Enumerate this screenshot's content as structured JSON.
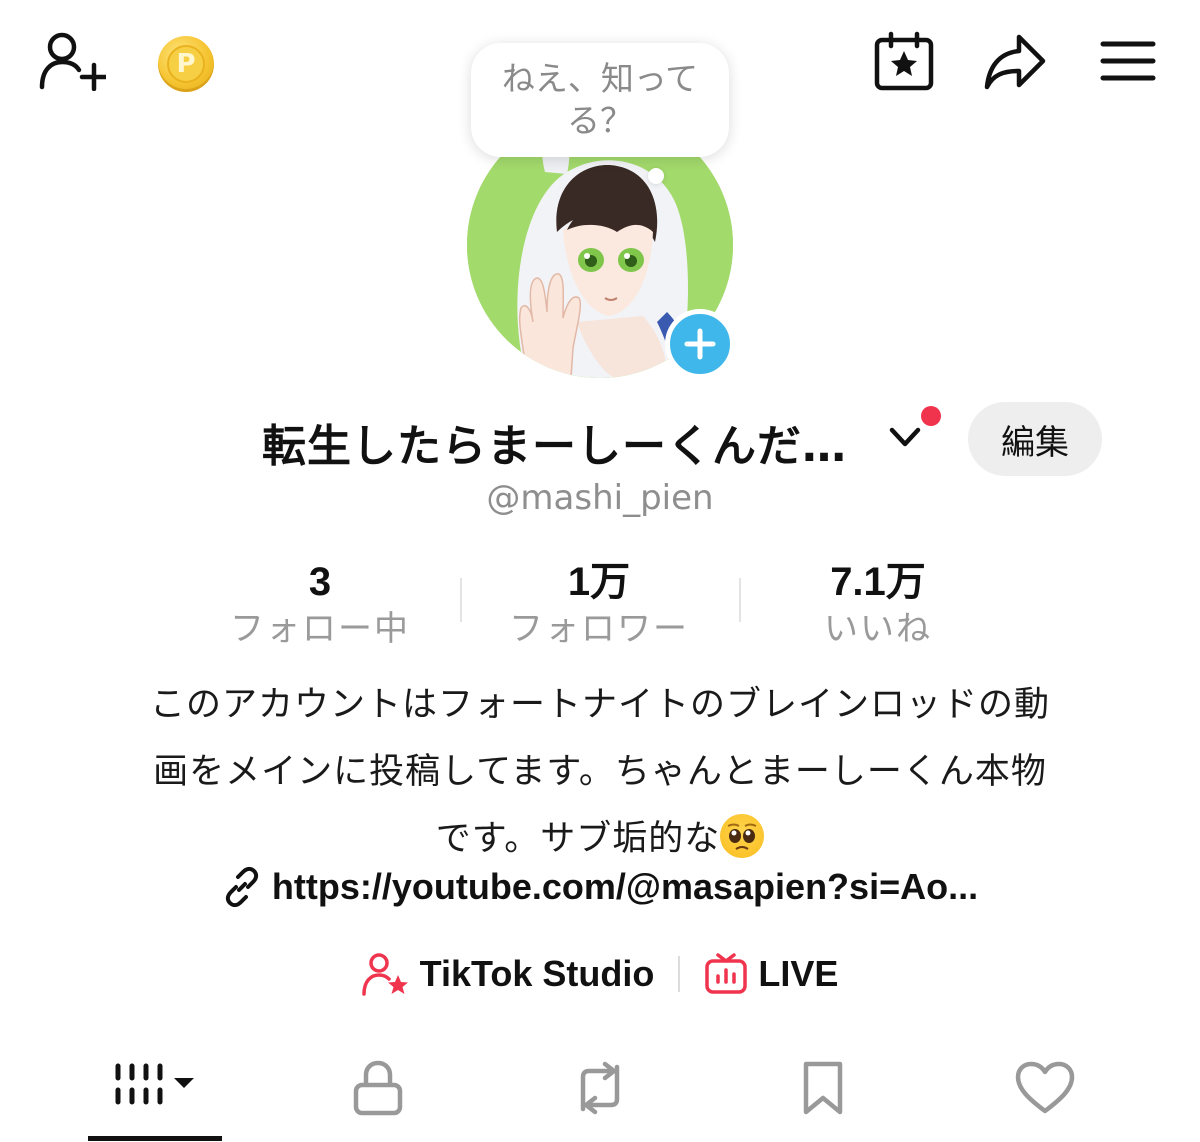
{
  "topbar": {
    "add_friend_icon": "person-add-icon",
    "coin_label": "P",
    "calendar_icon": "calendar-star-icon",
    "share_icon": "share-icon",
    "menu_icon": "hamburger-menu-icon"
  },
  "bubble": {
    "text": "ねえ、知ってる？"
  },
  "profile": {
    "avatar": "profile-avatar",
    "name": "転生したらまーしーくんだ…",
    "edit_label": "編集",
    "handle": "@mashi_pien"
  },
  "stats": [
    {
      "value": "3",
      "label": "フォロー中"
    },
    {
      "value": "1万",
      "label": "フォロワー"
    },
    {
      "value": "7.1万",
      "label": "いいね"
    }
  ],
  "bio": {
    "line1": "このアカウントはフォートナイトのブレインロッドの動",
    "line2": "画をメインに投稿してます。ちゃんとまーしーくん本物",
    "line3": "です。サブ垢的な",
    "emoji": "pleading-face-emoji",
    "link": "https://youtube.com/@masapien?si=Ao..."
  },
  "tools": {
    "studio_label": "TikTok Studio",
    "live_label": "LIVE",
    "accent": "#f0344e"
  },
  "tabs": [
    {
      "name": "videos",
      "icon": "grid-icon"
    },
    {
      "name": "private",
      "icon": "lock-icon"
    },
    {
      "name": "reposts",
      "icon": "repost-icon"
    },
    {
      "name": "favorites",
      "icon": "bookmark-icon"
    },
    {
      "name": "liked",
      "icon": "heart-icon"
    }
  ]
}
